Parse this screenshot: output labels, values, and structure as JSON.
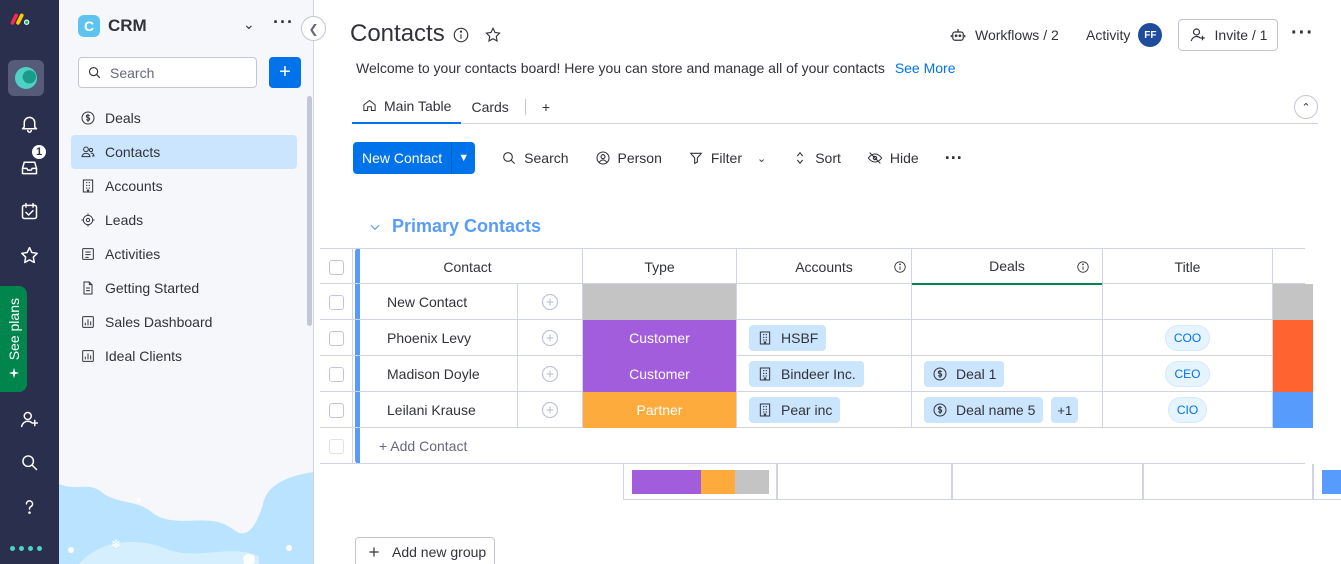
{
  "rail": {
    "inbox_badge": "1",
    "see_plans": "See plans"
  },
  "sidebar": {
    "workspace_initial": "C",
    "workspace_name": "CRM",
    "search_placeholder": "Search",
    "items": [
      {
        "label": "Deals",
        "icon": "dollar-circle-icon"
      },
      {
        "label": "Contacts",
        "icon": "contacts-icon"
      },
      {
        "label": "Accounts",
        "icon": "building-icon"
      },
      {
        "label": "Leads",
        "icon": "target-icon"
      },
      {
        "label": "Activities",
        "icon": "list-icon"
      },
      {
        "label": "Getting Started",
        "icon": "document-icon"
      },
      {
        "label": "Sales Dashboard",
        "icon": "dashboard-icon"
      },
      {
        "label": "Ideal Clients",
        "icon": "dashboard-icon"
      }
    ],
    "active_index": 1
  },
  "header": {
    "title": "Contacts",
    "workflows": "Workflows / 2",
    "activity": "Activity",
    "avatar_initials": "FF",
    "invite": "Invite / 1",
    "description": "Welcome to your contacts board! Here you can store and manage all of your contacts",
    "see_more": "See More"
  },
  "tabs": {
    "main_table": "Main Table",
    "cards": "Cards",
    "add": "+"
  },
  "toolbar": {
    "new_contact": "New Contact",
    "search": "Search",
    "person": "Person",
    "filter": "Filter",
    "sort": "Sort",
    "hide": "Hide"
  },
  "group": {
    "title": "Primary Contacts",
    "columns": {
      "contact": "Contact",
      "type": "Type",
      "accounts": "Accounts",
      "deals": "Deals",
      "title": "Title"
    },
    "rows": [
      {
        "name": "New Contact",
        "type": "",
        "type_color": "#c4c4c4",
        "account": "",
        "deals": [],
        "title": "",
        "extra_color": "#c4c4c4"
      },
      {
        "name": "Phoenix Levy",
        "type": "Customer",
        "type_color": "#a25ddc",
        "account": "HSBF",
        "deals": [],
        "title": "COO",
        "extra_color": "#ff642e"
      },
      {
        "name": "Madison Doyle",
        "type": "Customer",
        "type_color": "#a25ddc",
        "account": "Bindeer Inc.",
        "deals": [
          "Deal 1"
        ],
        "title": "CEO",
        "extra_color": "#ff642e"
      },
      {
        "name": "Leilani Krause",
        "type": "Partner",
        "type_color": "#fdab3d",
        "account": "Pear inc",
        "deals": [
          "Deal name 5"
        ],
        "deals_more": "+1",
        "title": "CIO",
        "extra_color": "#579bfc"
      }
    ],
    "add_contact": "+ Add Contact",
    "summary_type": [
      {
        "color": "#a25ddc",
        "share": 0.5
      },
      {
        "color": "#fdab3d",
        "share": 0.25
      },
      {
        "color": "#c4c4c4",
        "share": 0.25
      }
    ]
  },
  "add_group": "Add new group"
}
